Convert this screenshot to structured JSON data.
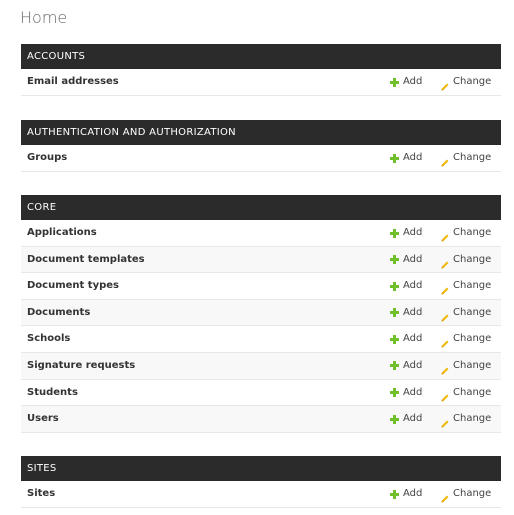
{
  "page": {
    "title": "Home"
  },
  "actions": {
    "add_label": "Add",
    "change_label": "Change"
  },
  "modules": [
    {
      "caption": "ACCOUNTS",
      "models": [
        "Email addresses"
      ]
    },
    {
      "caption": "AUTHENTICATION AND AUTHORIZATION",
      "models": [
        "Groups"
      ]
    },
    {
      "caption": "CORE",
      "models": [
        "Applications",
        "Document templates",
        "Document types",
        "Documents",
        "Schools",
        "Signature requests",
        "Students",
        "Users"
      ]
    },
    {
      "caption": "SITES",
      "models": [
        "Sites"
      ]
    }
  ],
  "colors": {
    "header_bg": "#2b2b2b",
    "add_icon": "#70bf2b",
    "change_icon": "#efb80b",
    "alt_row": "#f8f8f8"
  }
}
